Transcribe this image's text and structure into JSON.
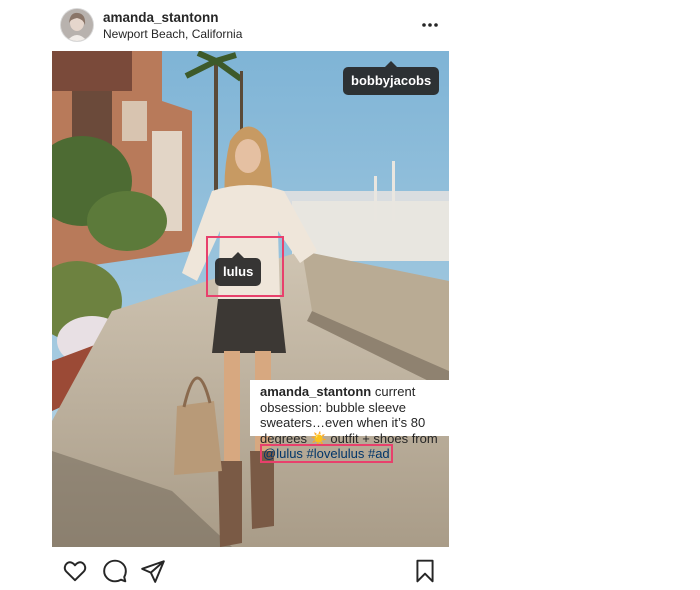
{
  "post": {
    "username": "amanda_stantonn",
    "location": "Newport Beach, California",
    "more_icon": "more-horizontal-icon"
  },
  "tags": {
    "top_right": "bobbyjacobs",
    "center": "lulus"
  },
  "caption": {
    "username": "amanda_stantonn",
    "text_before_emoji": " current obsession: bubble sleeve sweaters…even when it’s 80 degrees ",
    "emoji": "☀️",
    "text_after_emoji": " outfit + shoes from ",
    "mentions": "@lulus #lovelulus #ad"
  },
  "actions": {
    "like_icon": "heart-icon",
    "comment_icon": "comment-icon",
    "share_icon": "send-icon",
    "save_icon": "bookmark-icon"
  },
  "colors": {
    "highlight": "#e8406c",
    "link": "#003569",
    "tag_bg": "#262626"
  }
}
